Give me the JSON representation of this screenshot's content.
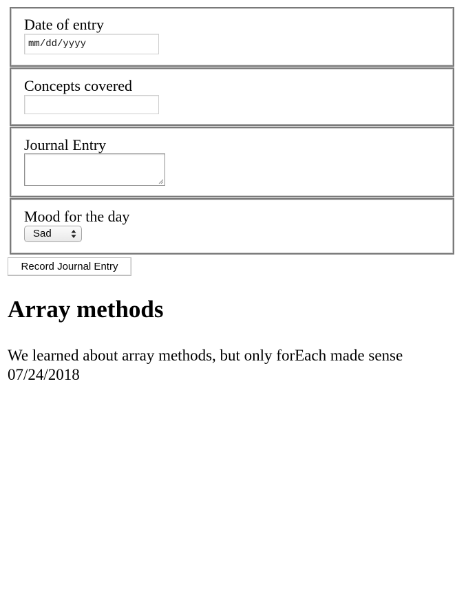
{
  "form": {
    "date_of_entry": {
      "label": "Date of entry",
      "placeholder": "mm/dd/yyyy"
    },
    "concepts_covered": {
      "label": "Concepts covered",
      "value": ""
    },
    "journal_entry": {
      "label": "Journal Entry",
      "value": ""
    },
    "mood": {
      "label": "Mood for the day",
      "selected": "Sad",
      "icon": "updown-arrows-icon"
    },
    "submit_label": "Record Journal Entry"
  },
  "entries": [
    {
      "title": "Array methods",
      "body": "We learned about array methods, but only forEach made sense",
      "date": "07/24/2018"
    }
  ]
}
